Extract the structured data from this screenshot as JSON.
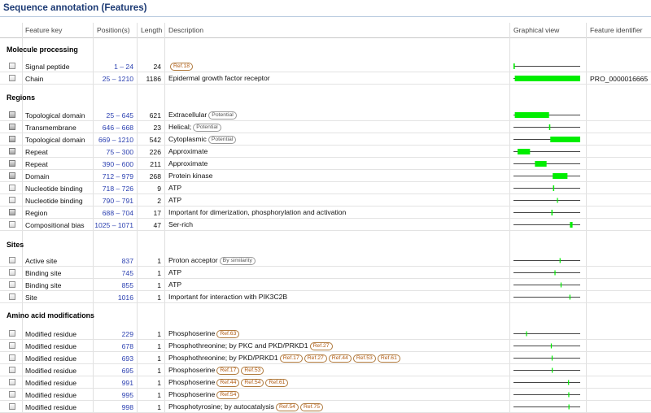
{
  "title": "Sequence annotation (Features)",
  "headers": {
    "feature_key": "Feature key",
    "positions": "Position(s)",
    "length": "Length",
    "description": "Description",
    "graphical_view": "Graphical view",
    "feature_identifier": "Feature identifier"
  },
  "sequence_length": 1210,
  "colors": {
    "bar": "#00ee00",
    "line": "#444444",
    "link": "#2a3fb0",
    "title": "#1c3a74",
    "ref_badge": "#b05a10"
  },
  "sections": [
    {
      "title": "Molecule processing",
      "rows": [
        {
          "key": "Signal peptide",
          "positions": "1 – 24",
          "start": 1,
          "end": 24,
          "length": "24",
          "description": "",
          "badges": [
            "Ref.18"
          ],
          "badge_style": "ref",
          "identifier": "",
          "checkbox": "light"
        },
        {
          "key": "Chain",
          "positions": "25 – 1210",
          "start": 25,
          "end": 1210,
          "length": "1186",
          "description": "Epidermal growth factor receptor",
          "badges": [],
          "badge_style": "ref",
          "identifier": "PRO_0000016665",
          "checkbox": "light"
        }
      ]
    },
    {
      "title": "Regions",
      "rows": [
        {
          "key": "Topological domain",
          "positions": "25 – 645",
          "start": 25,
          "end": 645,
          "length": "621",
          "description": "Extracellular",
          "badges": [
            "Potential"
          ],
          "badge_style": "grey",
          "identifier": "",
          "checkbox": "dark"
        },
        {
          "key": "Transmembrane",
          "positions": "646 – 668",
          "start": 646,
          "end": 668,
          "length": "23",
          "description": "Helical;",
          "badges": [
            "Potential"
          ],
          "badge_style": "grey",
          "identifier": "",
          "checkbox": "dark"
        },
        {
          "key": "Topological domain",
          "positions": "669 – 1210",
          "start": 669,
          "end": 1210,
          "length": "542",
          "description": "Cytoplasmic",
          "badges": [
            "Potential"
          ],
          "badge_style": "grey",
          "identifier": "",
          "checkbox": "dark"
        },
        {
          "key": "Repeat",
          "positions": "75 – 300",
          "start": 75,
          "end": 300,
          "length": "226",
          "description": "Approximate",
          "badges": [],
          "badge_style": "ref",
          "identifier": "",
          "checkbox": "dark"
        },
        {
          "key": "Repeat",
          "positions": "390 – 600",
          "start": 390,
          "end": 600,
          "length": "211",
          "description": "Approximate",
          "badges": [],
          "badge_style": "ref",
          "identifier": "",
          "checkbox": "dark"
        },
        {
          "key": "Domain",
          "positions": "712 – 979",
          "start": 712,
          "end": 979,
          "length": "268",
          "description": "Protein kinase",
          "badges": [],
          "badge_style": "ref",
          "identifier": "",
          "checkbox": "dark"
        },
        {
          "key": "Nucleotide binding",
          "positions": "718 – 726",
          "start": 718,
          "end": 726,
          "length": "9",
          "description": "ATP",
          "badges": [],
          "badge_style": "ref",
          "identifier": "",
          "checkbox": "light"
        },
        {
          "key": "Nucleotide binding",
          "positions": "790 – 791",
          "start": 790,
          "end": 791,
          "length": "2",
          "description": "ATP",
          "badges": [],
          "badge_style": "ref",
          "identifier": "",
          "checkbox": "light"
        },
        {
          "key": "Region",
          "positions": "688 – 704",
          "start": 688,
          "end": 704,
          "length": "17",
          "description": "Important for dimerization, phosphorylation and activation",
          "badges": [],
          "badge_style": "ref",
          "identifier": "",
          "checkbox": "dark"
        },
        {
          "key": "Compositional bias",
          "positions": "1025 – 1071",
          "start": 1025,
          "end": 1071,
          "length": "47",
          "description": "Ser-rich",
          "badges": [],
          "badge_style": "ref",
          "identifier": "",
          "checkbox": "light"
        }
      ]
    },
    {
      "title": "Sites",
      "rows": [
        {
          "key": "Active site",
          "positions": "837",
          "start": 837,
          "end": 837,
          "length": "1",
          "description": "Proton acceptor",
          "badges": [
            "By similarity"
          ],
          "badge_style": "grey",
          "identifier": "",
          "checkbox": "light"
        },
        {
          "key": "Binding site",
          "positions": "745",
          "start": 745,
          "end": 745,
          "length": "1",
          "description": "ATP",
          "badges": [],
          "badge_style": "ref",
          "identifier": "",
          "checkbox": "light"
        },
        {
          "key": "Binding site",
          "positions": "855",
          "start": 855,
          "end": 855,
          "length": "1",
          "description": "ATP",
          "badges": [],
          "badge_style": "ref",
          "identifier": "",
          "checkbox": "light"
        },
        {
          "key": "Site",
          "positions": "1016",
          "start": 1016,
          "end": 1016,
          "length": "1",
          "description": "Important for interaction with PIK3C2B",
          "badges": [],
          "badge_style": "ref",
          "identifier": "",
          "checkbox": "light"
        }
      ]
    },
    {
      "title": "Amino acid modifications",
      "rows": [
        {
          "key": "Modified residue",
          "positions": "229",
          "start": 229,
          "end": 229,
          "length": "1",
          "description": "Phosphoserine",
          "badges": [
            "Ref.63"
          ],
          "badge_style": "ref",
          "identifier": "",
          "checkbox": "light"
        },
        {
          "key": "Modified residue",
          "positions": "678",
          "start": 678,
          "end": 678,
          "length": "1",
          "description": "Phosphothreonine; by PKC and PKD/PRKD1",
          "badges": [
            "Ref.27"
          ],
          "badge_style": "ref",
          "identifier": "",
          "checkbox": "light"
        },
        {
          "key": "Modified residue",
          "positions": "693",
          "start": 693,
          "end": 693,
          "length": "1",
          "description": "Phosphothreonine; by PKD/PRKD1",
          "badges": [
            "Ref.17",
            "Ref.27",
            "Ref.44",
            "Ref.53",
            "Ref.61"
          ],
          "badge_style": "ref",
          "identifier": "",
          "checkbox": "light"
        },
        {
          "key": "Modified residue",
          "positions": "695",
          "start": 695,
          "end": 695,
          "length": "1",
          "description": "Phosphoserine",
          "badges": [
            "Ref.17",
            "Ref.53"
          ],
          "badge_style": "ref",
          "identifier": "",
          "checkbox": "light"
        },
        {
          "key": "Modified residue",
          "positions": "991",
          "start": 991,
          "end": 991,
          "length": "1",
          "description": "Phosphoserine",
          "badges": [
            "Ref.44",
            "Ref.54",
            "Ref.61"
          ],
          "badge_style": "ref",
          "identifier": "",
          "checkbox": "light"
        },
        {
          "key": "Modified residue",
          "positions": "995",
          "start": 995,
          "end": 995,
          "length": "1",
          "description": "Phosphoserine",
          "badges": [
            "Ref.54"
          ],
          "badge_style": "ref",
          "identifier": "",
          "checkbox": "light"
        },
        {
          "key": "Modified residue",
          "positions": "998",
          "start": 998,
          "end": 998,
          "length": "1",
          "description": "Phosphotyrosine; by autocatalysis",
          "badges": [
            "Ref.54",
            "Ref.75"
          ],
          "badge_style": "ref",
          "identifier": "",
          "checkbox": "light"
        }
      ]
    }
  ]
}
